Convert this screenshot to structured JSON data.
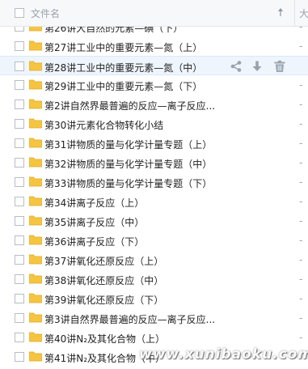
{
  "header": {
    "filename_label": "文件名",
    "sort_icon": "sort-arrow-icon",
    "col2_label": "大"
  },
  "rows": [
    {
      "name": "第26讲大自然的元素—碘（下）",
      "trail": "-"
    },
    {
      "name": "第27讲工业中的重要元素—氮（上）",
      "trail": "-"
    },
    {
      "name": "第28讲工业中的重要元素—氮（中）",
      "trail": ""
    },
    {
      "name": "第29讲工业中的重要元素—氮（下）",
      "trail": "-"
    },
    {
      "name": "第2讲自然界最普遍的反应—离子反应...",
      "trail": "-"
    },
    {
      "name": "第30讲元素化合物转化小结",
      "trail": "-"
    },
    {
      "name": "第31讲物质的量与化学计量专题（上）",
      "trail": "-"
    },
    {
      "name": "第32讲物质的量与化学计量专题（中）",
      "trail": "-"
    },
    {
      "name": "第33讲物质的量与化学计量专题（下）",
      "trail": "-"
    },
    {
      "name": "第34讲离子反应（上）",
      "trail": "-"
    },
    {
      "name": "第35讲离子反应（中）",
      "trail": "-"
    },
    {
      "name": "第36讲离子反应（下）",
      "trail": "-"
    },
    {
      "name": "第37讲氧化还原反应（上）",
      "trail": "-"
    },
    {
      "name": "第38讲氧化还原反应（中）",
      "trail": "-"
    },
    {
      "name": "第39讲氧化还原反应（下）",
      "trail": "-"
    },
    {
      "name": "第3讲自然界最普遍的反应—离子反应...",
      "trail": "-"
    },
    {
      "name": "第40讲N₂及其化合物（上）",
      "trail": "-"
    },
    {
      "name": "第41讲N₂及其化合物（中）",
      "trail": "-"
    }
  ],
  "hover_actions": [
    "share-icon",
    "download-icon",
    "delete-icon"
  ],
  "watermark": "www.xunibaoku.com",
  "colors": {
    "folder": "#f5c542",
    "folder_dark": "#e0a91e",
    "hover_bg": "#eef5fd",
    "action_icon": "#9aa2ad"
  }
}
